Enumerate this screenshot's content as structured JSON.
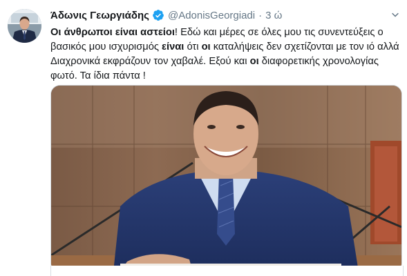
{
  "tweet": {
    "author_name": "Άδωνις Γεωργιάδης",
    "handle": "@AdonisGeorgiadi",
    "separator": "·",
    "time": "3 ώ",
    "text_parts": [
      {
        "t": "Οι άνθρωποι είναι αστείοι",
        "b": true
      },
      {
        "t": "! Εδώ και μέρες σε όλες μου τις συνεντεύξεις ο βασικός μου ισχυρισμός ",
        "b": false
      },
      {
        "t": "είναι",
        "b": true
      },
      {
        "t": " ότι ",
        "b": false
      },
      {
        "t": "οι",
        "b": true
      },
      {
        "t": " καταλήψεις δεν σχετίζονται με τον ιό αλλά Διαχρονικά εκφράζουν τον χαβαλέ. Εξού και ",
        "b": false
      },
      {
        "t": "οι",
        "b": true
      },
      {
        "t": " διαφορετικής χρονολογίας φωτό. Τα ίδια πάντα !",
        "b": false
      }
    ]
  },
  "icons": {
    "verified": "verified-badge-icon",
    "more": "chevron-down-icon"
  },
  "colors": {
    "verified": "#1da1f2",
    "secondary_text": "#657786",
    "primary_text": "#14171a"
  }
}
